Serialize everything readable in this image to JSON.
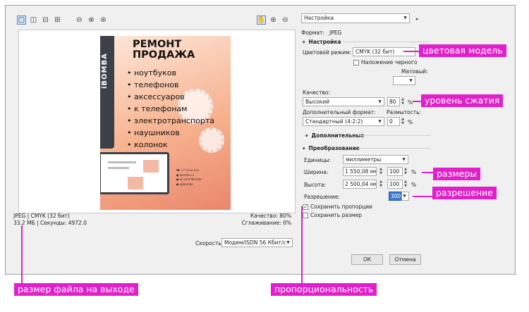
{
  "preset": "Настройка",
  "format": {
    "label": "Формат:",
    "value": "JPEG"
  },
  "settings": {
    "title": "Настройка",
    "color_mode_label": "Цветовой режим:",
    "color_mode_value": "CMYK (32 бит)",
    "overprint_label": "Наложение черного",
    "matte_label": "Матовый:",
    "quality_label": "Качество:",
    "quality_value": "Высокий",
    "quality_number": "80",
    "percent": "%",
    "subformat_label": "Дополнительный формат:",
    "subformat_value": "Стандартный (4:2:2)",
    "blur_label": "Размытость:",
    "blur_value": "0"
  },
  "advanced": {
    "title": "Дополнительные"
  },
  "transform": {
    "title": "Преобразование",
    "units_label": "Единицы:",
    "units_value": "миллиметры",
    "width_label": "Ширина:",
    "width_value": "1 550,08 мм",
    "width_pct": "100",
    "height_label": "Высота:",
    "height_value": "2 500,04 мм",
    "height_pct": "100",
    "resolution_label": "Разрешение:",
    "resolution_value": "300",
    "keep_ratio_label": "Сохранить пропорции",
    "keep_size_label": "Сохранить размер"
  },
  "preview_info": {
    "line1": "JPEG  |  CMYK (32 бит)",
    "line2": "33.2 МБ  |  Секунды: 4972.0",
    "quality": "Качество: 80%",
    "smoothing": "Сглаживание: 0%"
  },
  "speed": {
    "label": "Скорость:",
    "value": "Модем/ISDN 56 Кбит/с"
  },
  "buttons": {
    "ok": "ОК",
    "cancel": "Отмена"
  },
  "poster": {
    "logo": "iBOMBA",
    "title1": "РЕМОНТ",
    "title2": "ПРОДАЖА",
    "items": [
      "• ноутбуков",
      "• телефонов",
      "• аксессуаров",
      "• к телефонам",
      "• электротранспорта",
      "• наушников",
      "• колонок"
    ],
    "contact": [
      "☎ +7 (xxx) xxx",
      "● ibomba.ru",
      "● vk.com/ibomba",
      "● @ibomba"
    ]
  },
  "callouts": {
    "color_model": "цветовая модель",
    "compression": "уровень сжатия",
    "sizes": "размеры",
    "resolution": "разрешение",
    "file_size": "размер файла на выходе",
    "proportionality": "пропорциональность"
  },
  "colors": {
    "accent": "#e020c8",
    "dialog_bg": "#f0f0f0"
  }
}
